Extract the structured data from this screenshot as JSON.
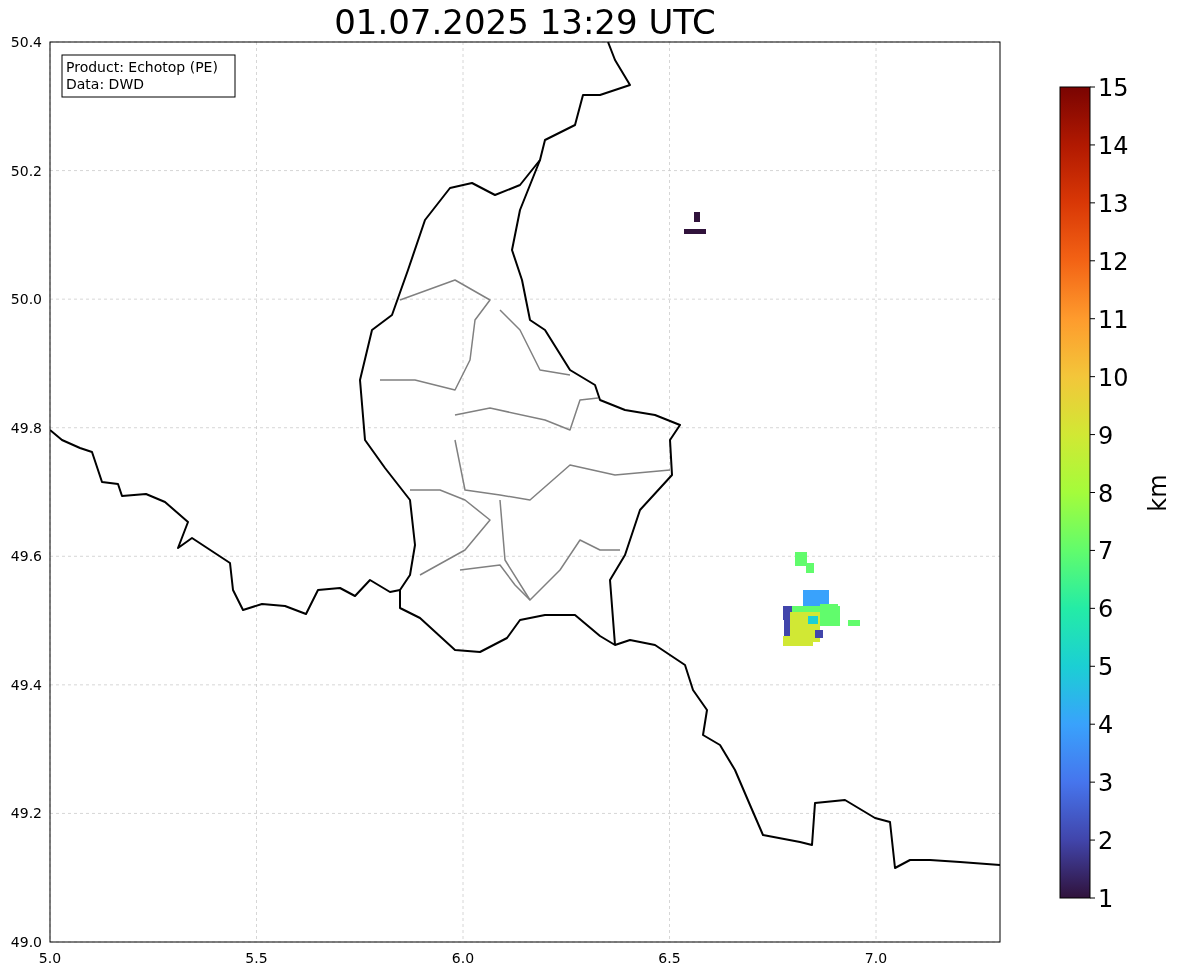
{
  "title": "01.07.2025 13:29 UTC",
  "info_box": {
    "lines": [
      "Product: Echotop (PE)",
      "Data: DWD"
    ]
  },
  "map": {
    "x_tick_labels": [
      "5.0",
      "5.5",
      "6.0",
      "6.5",
      "7.0"
    ],
    "y_tick_labels": [
      "50.4",
      "50.2",
      "50.0",
      "49.8",
      "49.6",
      "49.4",
      "49.2",
      "49.0"
    ]
  },
  "colorbar": {
    "label": "km",
    "tick_labels": [
      "15",
      "14",
      "13",
      "12",
      "11",
      "10",
      "9",
      "8",
      "7",
      "6",
      "5",
      "4",
      "3",
      "2",
      "1"
    ]
  }
}
